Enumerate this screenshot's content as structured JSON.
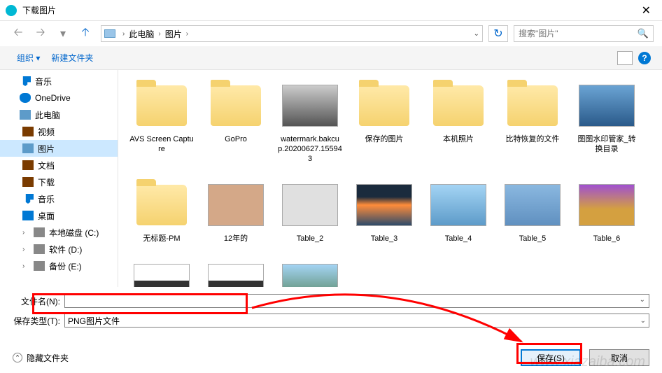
{
  "title": "下载图片",
  "nav": {
    "breadcrumb": [
      "此电脑",
      "图片"
    ],
    "search_placeholder": "搜索\"图片\""
  },
  "toolbar": {
    "organize": "组织",
    "new_folder": "新建文件夹"
  },
  "sidebar": {
    "items": [
      {
        "label": "音乐",
        "icon": "music"
      },
      {
        "label": "OneDrive",
        "icon": "onedrive"
      },
      {
        "label": "此电脑",
        "icon": "pc",
        "expandable": true
      },
      {
        "label": "视频",
        "icon": "video",
        "sub": true
      },
      {
        "label": "图片",
        "icon": "pic",
        "sub": true,
        "selected": true
      },
      {
        "label": "文档",
        "icon": "doc",
        "sub": true
      },
      {
        "label": "下载",
        "icon": "dl",
        "sub": true
      },
      {
        "label": "音乐",
        "icon": "music",
        "sub": true
      },
      {
        "label": "桌面",
        "icon": "desk",
        "sub": true
      },
      {
        "label": "本地磁盘 (C:)",
        "icon": "disk",
        "sub": true,
        "exp": true
      },
      {
        "label": "软件 (D:)",
        "icon": "disk",
        "sub": true,
        "exp": true
      },
      {
        "label": "备份 (E:)",
        "icon": "disk",
        "sub": true,
        "exp": true
      }
    ]
  },
  "files": [
    {
      "name": "AVS Screen Capture",
      "type": "folder"
    },
    {
      "name": "GoPro",
      "type": "folder"
    },
    {
      "name": "watermark.bakcup.20200627.155943",
      "type": "img",
      "thumb": "bw"
    },
    {
      "name": "保存的图片",
      "type": "folder"
    },
    {
      "name": "本机照片",
      "type": "folder"
    },
    {
      "name": "比特恢复的文件",
      "type": "folder"
    },
    {
      "name": "图图水印管家_转换目录",
      "type": "img",
      "thumb": "blue"
    },
    {
      "name": "无标题-PM",
      "type": "folder"
    },
    {
      "name": "12年的",
      "type": "img",
      "thumb": "boy"
    },
    {
      "name": "Table_2",
      "type": "img",
      "thumb": "car"
    },
    {
      "name": "Table_3",
      "type": "img",
      "thumb": "sunset"
    },
    {
      "name": "Table_4",
      "type": "img",
      "thumb": "lake"
    },
    {
      "name": "Table_5",
      "type": "img",
      "thumb": "castle"
    },
    {
      "name": "Table_6",
      "type": "img",
      "thumb": "purple"
    },
    {
      "name": "",
      "type": "img",
      "thumb": "person"
    },
    {
      "name": "",
      "type": "img",
      "thumb": "person"
    },
    {
      "name": "",
      "type": "img",
      "thumb": "mount"
    }
  ],
  "form": {
    "filename_label": "文件名(N):",
    "filename_value": "",
    "type_label": "保存类型(T):",
    "type_value": "PNG图片文件"
  },
  "footer": {
    "hide_folders": "隐藏文件夹",
    "save": "保存(S)",
    "cancel": "取消"
  },
  "watermark": "www.xiazaiba.com"
}
